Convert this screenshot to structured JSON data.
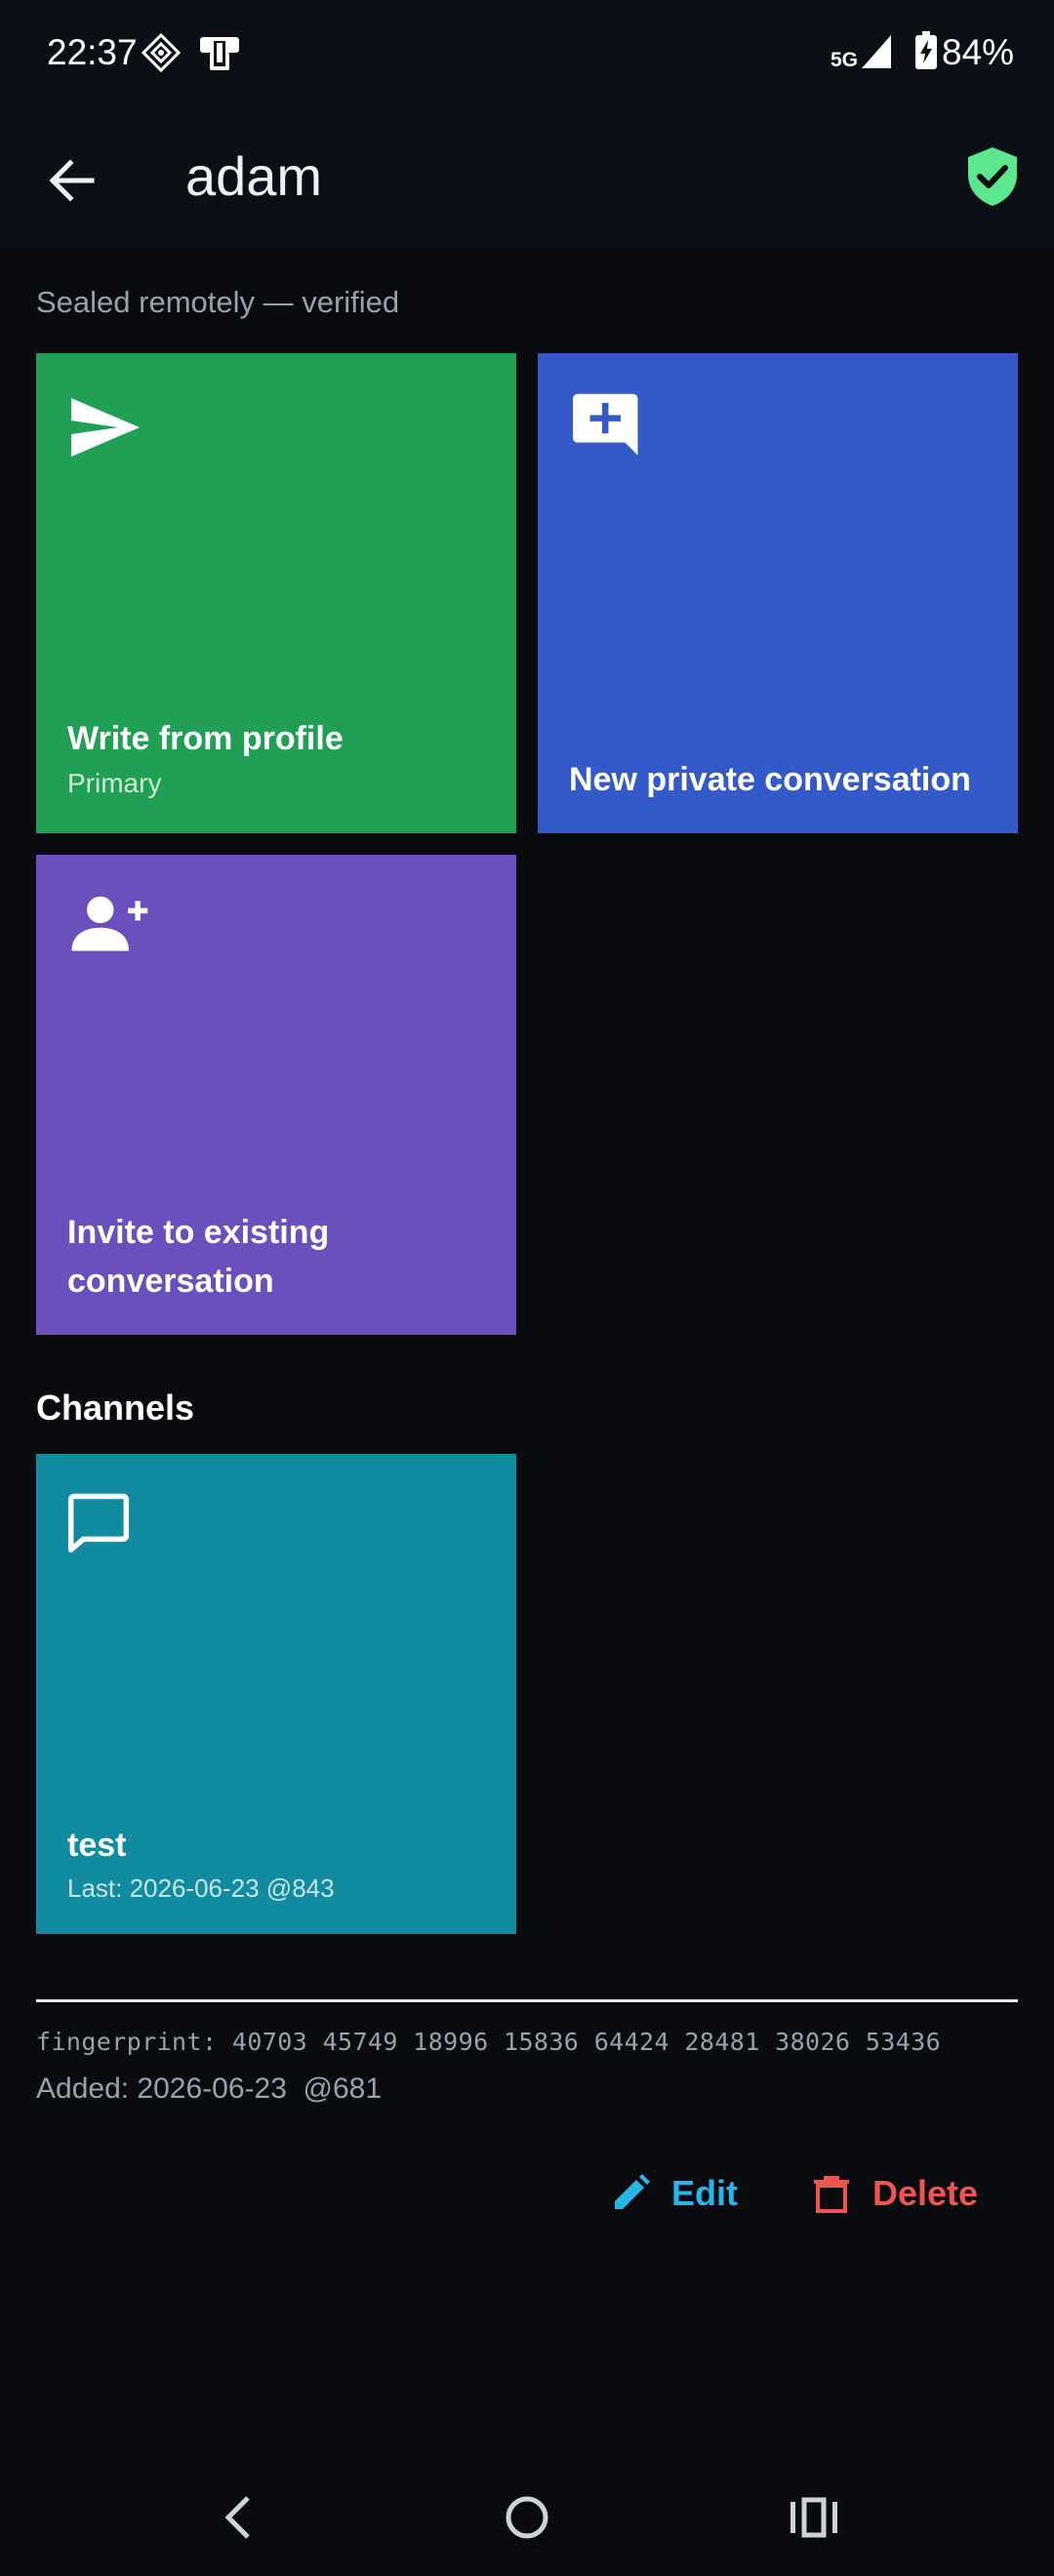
{
  "status_bar": {
    "time": "22:37",
    "network": "5G",
    "battery": "84%"
  },
  "app_bar": {
    "title": "adam"
  },
  "subtitle": "Sealed remotely — verified",
  "actions": {
    "write": {
      "label": "Write from profile",
      "sub": "Primary",
      "color": "#21a055",
      "icon": "send-icon"
    },
    "new_private": {
      "label": "New private conversation",
      "color": "#3459c9",
      "icon": "add-comment-icon"
    },
    "invite": {
      "label": "Invite to existing conversation",
      "color": "#6b50bd",
      "icon": "person-add-icon"
    }
  },
  "channels": {
    "heading": "Channels",
    "items": [
      {
        "name": "test",
        "last": "Last: 2026-06-23 @843",
        "color": "#108ba0",
        "icon": "chat-bubble-outline-icon"
      }
    ]
  },
  "fingerprint": "fingerprint: 40703 45749 18996 15836 64424 28481 38026 53436",
  "added": "Added: 2026-06-23  @681",
  "buttons": {
    "edit": {
      "label": "Edit",
      "color": "#27b6e8"
    },
    "delete": {
      "label": "Delete",
      "color": "#ee5450"
    }
  },
  "colors": {
    "background": "#090b0f",
    "verified_shield": "#5ce68e"
  }
}
